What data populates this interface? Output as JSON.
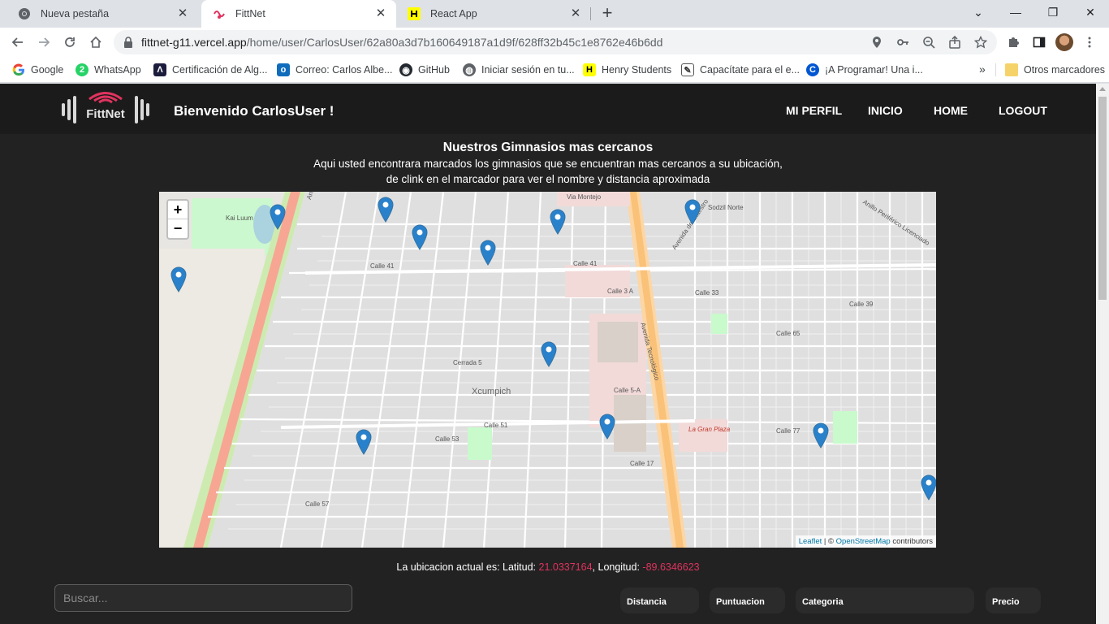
{
  "browser": {
    "tabs": [
      {
        "title": "Nueva pestaña",
        "icon": "chrome-icon"
      },
      {
        "title": "FittNet",
        "icon": "fittnet-icon",
        "active": true
      },
      {
        "title": "React App",
        "icon": "henry-icon"
      }
    ],
    "url": {
      "host": "fittnet-g11.vercel.app",
      "path": "/home/user/CarlosUser/62a80a3d7b160649187a1d9f/628ff32b45c1e8762e46b6dd"
    },
    "bookmarks": [
      {
        "label": "Google",
        "icon": "google-icon"
      },
      {
        "label": "WhatsApp",
        "icon": "whatsapp-icon"
      },
      {
        "label": "Certificación de Alg...",
        "icon": "algorithm-icon"
      },
      {
        "label": "Correo: Carlos Albe...",
        "icon": "outlook-icon"
      },
      {
        "label": "GitHub",
        "icon": "github-icon"
      },
      {
        "label": "Iniciar sesión en tu...",
        "icon": "globe-icon"
      },
      {
        "label": "Henry Students",
        "icon": "henry-icon"
      },
      {
        "label": "Capacítate para el e...",
        "icon": "course-icon"
      },
      {
        "label": "¡A Programar! Una i...",
        "icon": "coursera-icon"
      }
    ],
    "other_bookmarks": "Otros marcadores",
    "more": "»"
  },
  "header": {
    "logo_text": "FittNet",
    "welcome": "Bienvenido CarlosUser !",
    "nav": [
      "MI PERFIL",
      "INICIO",
      "HOME",
      "LOGOUT"
    ]
  },
  "main": {
    "title": "Nuestros Gimnasios mas cercanos",
    "subtitle_line1": "Aqui usted encontrara marcados los gimnasios que se encuentran mas cercanos a su ubicación,",
    "subtitle_line2": "de clink en el marcador para ver el nombre y distancia aproximada"
  },
  "map": {
    "zoom_in": "+",
    "zoom_out": "−",
    "attribution": {
      "leaflet": "Leaflet",
      "sep": " | © ",
      "osm": "OpenStreetMap",
      "suffix": " contributors"
    },
    "labels": {
      "xcumpich": "Xcumpich",
      "via_montejo": "Via Montejo",
      "sodzil_norte": "Sodzil Norte",
      "kai_luum": "Kai Luum",
      "la_gran_plaza": "La Gran Plaza",
      "av_tecnologico": "Avenida Tecnológico",
      "anillo_periferico": "Anillo Periférico Licenciado Manuel Berzunza",
      "anillo_periferico_ne": "Anillo Periférico Licenciado",
      "calle_41": "Calle 41",
      "calle_51": "Calle 51",
      "calle_39": "Calle 39",
      "calle_33": "Calle 33",
      "calle_3a": "Calle 3 A",
      "calle_5a": "Calle 5-A",
      "calle_17": "Calle 17",
      "calle_53": "Calle 53",
      "calle_77": "Calle 77",
      "calle_65": "Calle 65",
      "calle_57": "Calle 57",
      "cerrada_5": "Cerrada 5",
      "avenida_maestro": "Avenida del Maestro"
    }
  },
  "location": {
    "label": "La ubicacion actual es: Latitud: ",
    "lat": "21.0337164",
    "lon_label": ", Longitud: ",
    "lon": "-89.6346623"
  },
  "search": {
    "placeholder": "Buscar..."
  },
  "filters": [
    "Distancia",
    "Puntuacion",
    "Categoria",
    "Precio"
  ],
  "colors": {
    "page_bg": "#222222",
    "navbar_bg": "#1b1b1b",
    "accent": "#e0335e",
    "marker": "#2a81cb"
  }
}
